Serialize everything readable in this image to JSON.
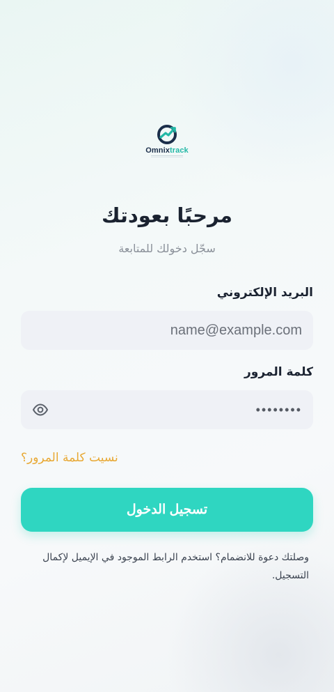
{
  "brand": {
    "name_main": "Omnix",
    "name_accent": "track",
    "logo_icon": "omnixtrack-logo-icon",
    "primary_color": "#2fd6c1",
    "accent_color": "#e8a833"
  },
  "header": {
    "title": "مرحبًا بعودتك",
    "subtitle": "سجّل دخولك للمتابعة"
  },
  "form": {
    "email_label": "البريد الإلكتروني",
    "email_placeholder": "name@example.com",
    "password_label": "كلمة المرور",
    "password_value": "••••••••",
    "toggle_icon": "eye-icon",
    "forgot_label": "نسيت كلمة المرور؟",
    "submit_label": "تسجيل الدخول"
  },
  "footer": {
    "invite_text": "وصلتك دعوة للانضمام؟ استخدم الرابط الموجود في الإيميل لإكمال التسجيل."
  }
}
